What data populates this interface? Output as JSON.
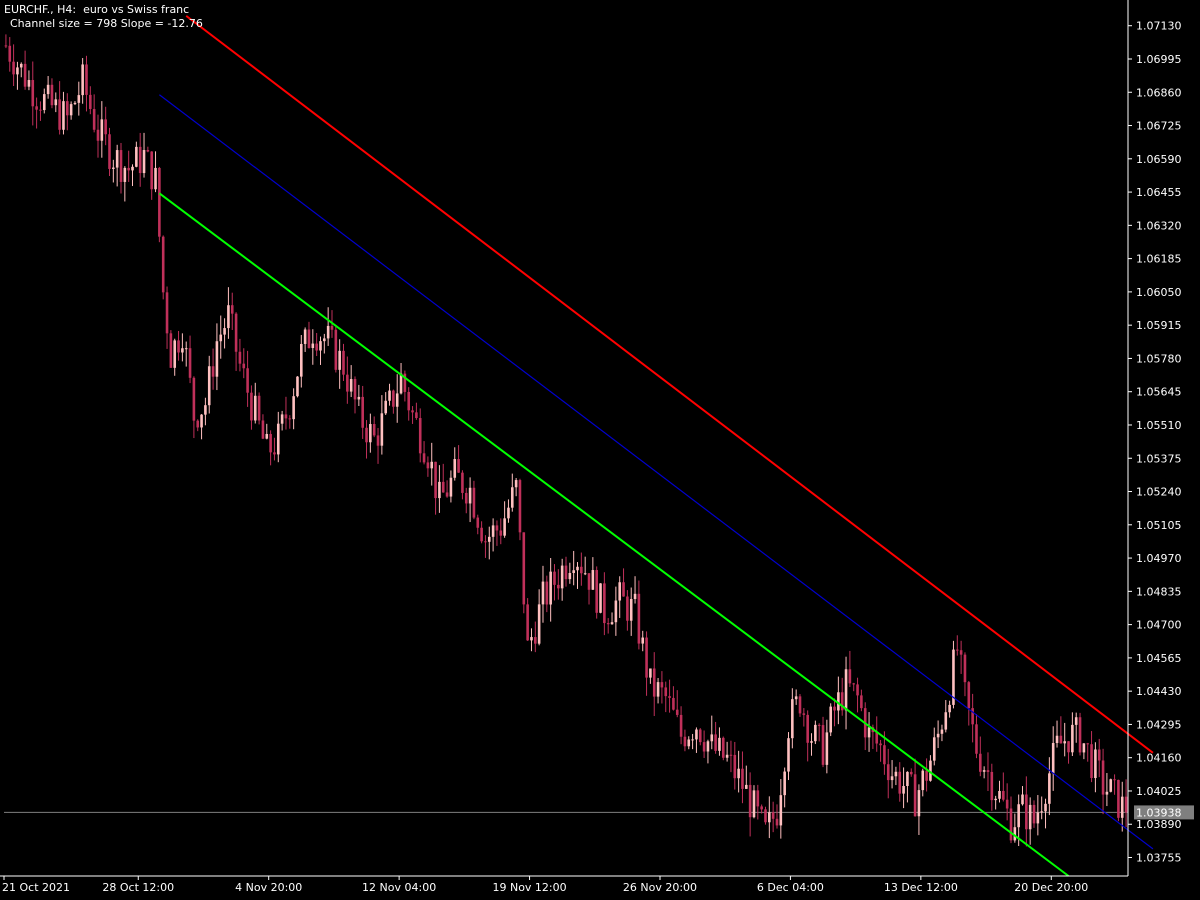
{
  "header": {
    "line1": "EURCHF., H4:  euro vs Swiss franc",
    "line2": "Channel size = 798 Slope = -12.76"
  },
  "colors": {
    "background": "#000000",
    "axis": "#ffffff",
    "bull": "#ffc0c0",
    "bear": "#c0305a",
    "upper": "#ff0000",
    "middle": "#0000cd",
    "lower": "#00ff00",
    "price_line": "#7f7f7f",
    "price_tag_bg": "#7f7f7f"
  },
  "chart_data": {
    "type": "candlestick",
    "symbol": "EURCHF.",
    "timeframe": "H4",
    "ylim": [
      1.0368,
      1.0721
    ],
    "y_ticks": [
      "1.07130",
      "1.06995",
      "1.06860",
      "1.06725",
      "1.06590",
      "1.06455",
      "1.06320",
      "1.06185",
      "1.06050",
      "1.05915",
      "1.05780",
      "1.05645",
      "1.05510",
      "1.05375",
      "1.05240",
      "1.05105",
      "1.04970",
      "1.04835",
      "1.04700",
      "1.04565",
      "1.04430",
      "1.04295",
      "1.04160",
      "1.04025",
      "1.03890",
      "1.03755"
    ],
    "x_ticks": [
      {
        "label": "21 Oct 2021",
        "bar": 0
      },
      {
        "label": "28 Oct 12:00",
        "bar": 35
      },
      {
        "label": "4 Nov 20:00",
        "bar": 69
      },
      {
        "label": "12 Nov 04:00",
        "bar": 103
      },
      {
        "label": "19 Nov 12:00",
        "bar": 137
      },
      {
        "label": "26 Nov 20:00",
        "bar": 171
      },
      {
        "label": "6 Dec 04:00",
        "bar": 205
      },
      {
        "label": "13 Dec 12:00",
        "bar": 239
      },
      {
        "label": "20 Dec 20:00",
        "bar": 273
      }
    ],
    "current_price": "1.03938",
    "channel": {
      "upper": {
        "start_bar": 47,
        "start": 1.0717,
        "end_bar": 299,
        "end": 1.0418
      },
      "middle": {
        "start_bar": 40,
        "start": 1.0685,
        "end_bar": 299,
        "end": 1.0379
      },
      "lower": {
        "start_bar": 40,
        "start": 1.0645,
        "end_bar": 277,
        "end": 1.0368
      }
    },
    "anchors": [
      [
        0,
        1.0705
      ],
      [
        8,
        1.0685
      ],
      [
        12,
        1.068
      ],
      [
        16,
        1.0675
      ],
      [
        20,
        1.069
      ],
      [
        24,
        1.067
      ],
      [
        28,
        1.066
      ],
      [
        32,
        1.0655
      ],
      [
        36,
        1.066
      ],
      [
        39,
        1.065
      ],
      [
        41,
        1.0605
      ],
      [
        43,
        1.058
      ],
      [
        46,
        1.059
      ],
      [
        49,
        1.0555
      ],
      [
        52,
        1.056
      ],
      [
        55,
        1.0585
      ],
      [
        58,
        1.0595
      ],
      [
        61,
        1.0575
      ],
      [
        64,
        1.056
      ],
      [
        68,
        1.054
      ],
      [
        71,
        1.0545
      ],
      [
        74,
        1.056
      ],
      [
        77,
        1.058
      ],
      [
        80,
        1.059
      ],
      [
        84,
        1.0585
      ],
      [
        88,
        1.0575
      ],
      [
        92,
        1.0555
      ],
      [
        96,
        1.0545
      ],
      [
        99,
        1.0555
      ],
      [
        103,
        1.057
      ],
      [
        106,
        1.0555
      ],
      [
        110,
        1.054
      ],
      [
        113,
        1.052
      ],
      [
        117,
        1.053
      ],
      [
        121,
        1.0525
      ],
      [
        125,
        1.0505
      ],
      [
        129,
        1.051
      ],
      [
        133,
        1.0525
      ],
      [
        136,
        1.046
      ],
      [
        140,
        1.048
      ],
      [
        144,
        1.049
      ],
      [
        148,
        1.05
      ],
      [
        152,
        1.049
      ],
      [
        156,
        1.0475
      ],
      [
        160,
        1.048
      ],
      [
        164,
        1.0475
      ],
      [
        168,
        1.0445
      ],
      [
        172,
        1.044
      ],
      [
        176,
        1.0425
      ],
      [
        180,
        1.043
      ],
      [
        184,
        1.042
      ],
      [
        188,
        1.0415
      ],
      [
        192,
        1.0405
      ],
      [
        195,
        1.0395
      ],
      [
        198,
        1.0385
      ],
      [
        201,
        1.0395
      ],
      [
        204,
        1.043
      ],
      [
        207,
        1.044
      ],
      [
        210,
        1.0425
      ],
      [
        213,
        1.042
      ],
      [
        216,
        1.0435
      ],
      [
        219,
        1.0445
      ],
      [
        222,
        1.044
      ],
      [
        225,
        1.0425
      ],
      [
        228,
        1.042
      ],
      [
        231,
        1.041
      ],
      [
        234,
        1.0405
      ],
      [
        237,
        1.04
      ],
      [
        240,
        1.041
      ],
      [
        243,
        1.0425
      ],
      [
        246,
        1.0445
      ],
      [
        248,
        1.046
      ],
      [
        250,
        1.044
      ],
      [
        253,
        1.042
      ],
      [
        256,
        1.041
      ],
      [
        259,
        1.04
      ],
      [
        262,
        1.039
      ],
      [
        265,
        1.0395
      ],
      [
        268,
        1.039
      ],
      [
        271,
        1.0405
      ],
      [
        274,
        1.042
      ],
      [
        277,
        1.0425
      ],
      [
        280,
        1.0425
      ],
      [
        283,
        1.0415
      ],
      [
        286,
        1.0405
      ],
      [
        289,
        1.04
      ],
      [
        292,
        1.03938
      ]
    ],
    "bar_count": 293
  }
}
